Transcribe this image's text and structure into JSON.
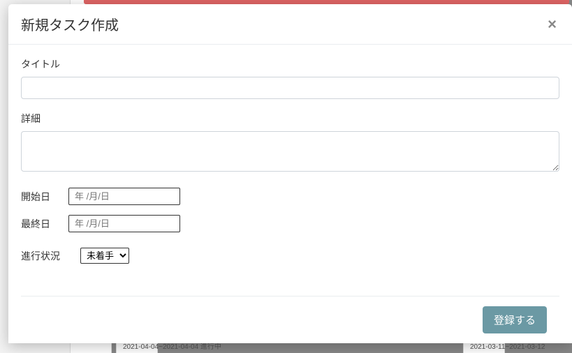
{
  "modal": {
    "title": "新規タスク作成",
    "close": "×"
  },
  "form": {
    "title_label": "タイトル",
    "title_value": "",
    "detail_label": "詳細",
    "detail_value": "",
    "start_label": "開始日",
    "start_placeholder": "年 /月/日",
    "end_label": "最終日",
    "end_placeholder": "年 /月/日",
    "status_label": "進行状況",
    "status_selected": "未着手",
    "submit_label": "登録する"
  },
  "background": {
    "date1": "2021-04-04~2021-04-04  進行中",
    "date2": "2021-03-11~2021-03-12"
  }
}
